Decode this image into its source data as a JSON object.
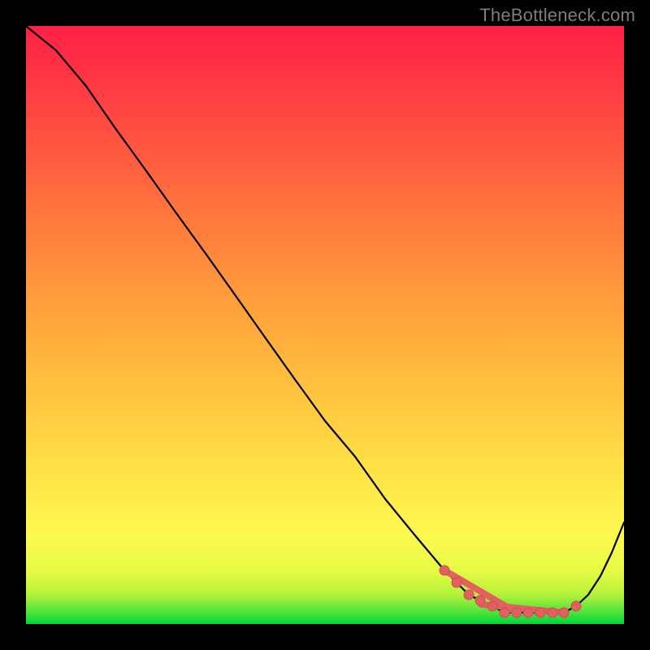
{
  "watermark": "TheBottleneck.com",
  "colors": {
    "background_frame": "#000000",
    "gradient_top": "#ff2146",
    "gradient_mid": "#ffe347",
    "gradient_bottom": "#00d63a",
    "line": "#000000",
    "markers": "#e16060"
  },
  "chart_data": {
    "type": "line",
    "title": "",
    "xlabel": "",
    "ylabel": "",
    "xlim": [
      0,
      100
    ],
    "ylim": [
      0,
      100
    ],
    "grid": false,
    "legend": false,
    "x": [
      0,
      5,
      10,
      15,
      20,
      25,
      30,
      35,
      40,
      45,
      50,
      55,
      60,
      65,
      70,
      72,
      74,
      76,
      78,
      80,
      82,
      84,
      86,
      88,
      90,
      92,
      94,
      96,
      98,
      100
    ],
    "values": [
      100,
      96,
      90,
      83,
      76,
      69,
      62,
      55,
      48,
      41,
      34,
      28,
      21,
      15,
      9,
      7,
      5,
      4,
      3,
      2,
      2,
      2,
      2,
      2,
      2,
      3,
      5,
      8,
      12,
      17
    ],
    "markers": {
      "x": [
        70,
        72,
        74,
        76,
        78,
        80,
        82,
        84,
        86,
        88,
        90,
        92
      ],
      "values": [
        9,
        7,
        5,
        4,
        3,
        2,
        2,
        2,
        2,
        2,
        2,
        3
      ]
    },
    "annotation": "Watermark only; no axis ticks or labels visible."
  }
}
